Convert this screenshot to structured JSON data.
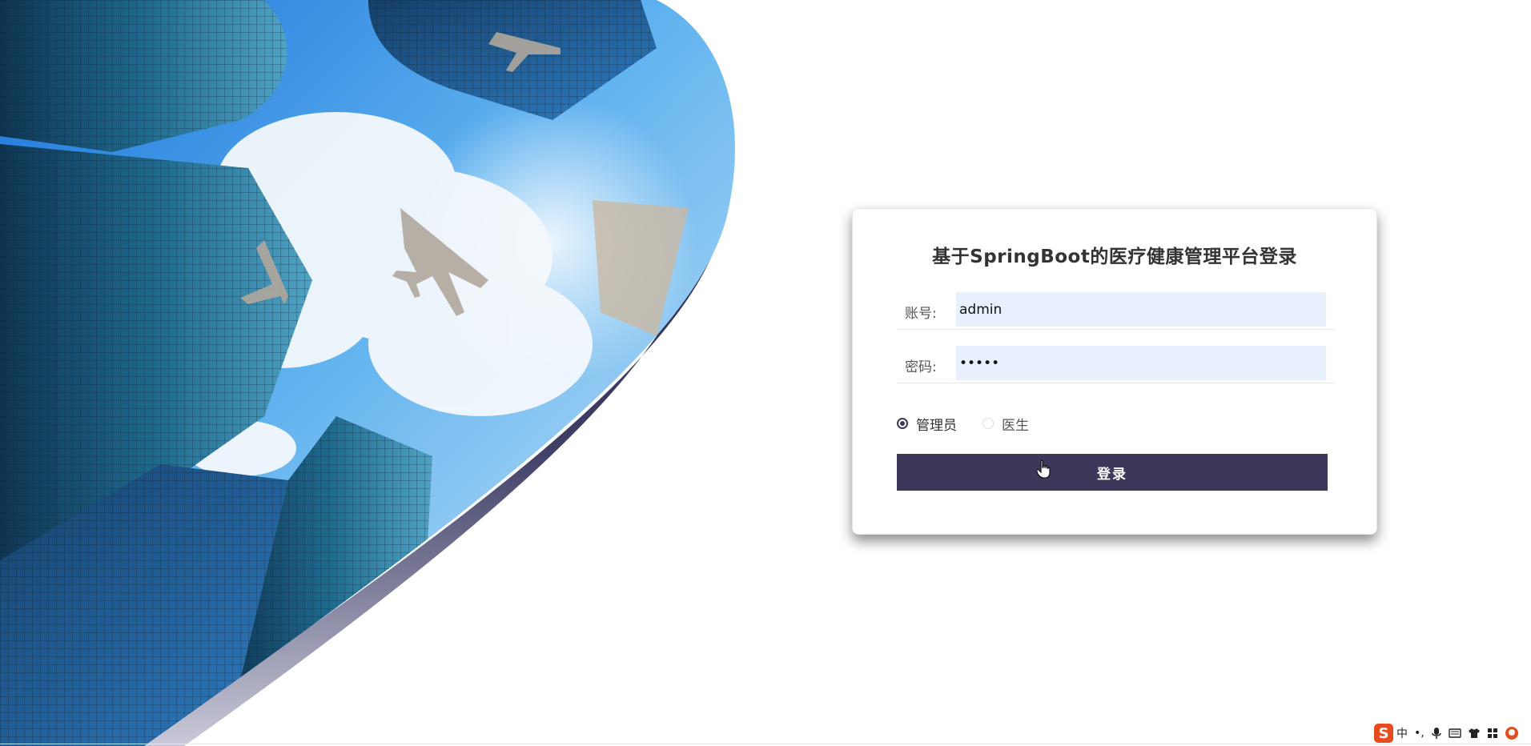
{
  "login": {
    "title": "基于SpringBoot的医疗健康管理平台登录",
    "account_label": "账号:",
    "account_value": "admin",
    "password_label": "密码:",
    "password_value": "•••••",
    "roles": [
      {
        "label": "管理员",
        "selected": true
      },
      {
        "label": "医生",
        "selected": false
      }
    ],
    "submit_label": "登录"
  },
  "ime_tray": {
    "logo": "S",
    "mode": "中",
    "punct": "•,",
    "icons": [
      "mic-icon",
      "keyboard-icon",
      "shirt-icon",
      "grid-icon",
      "avatar-icon"
    ]
  },
  "colors": {
    "primary": "#3d3759",
    "input_bg": "#e8f0fe",
    "sky_top": "#1f7fdc",
    "ime_brand": "#e84c1e"
  }
}
